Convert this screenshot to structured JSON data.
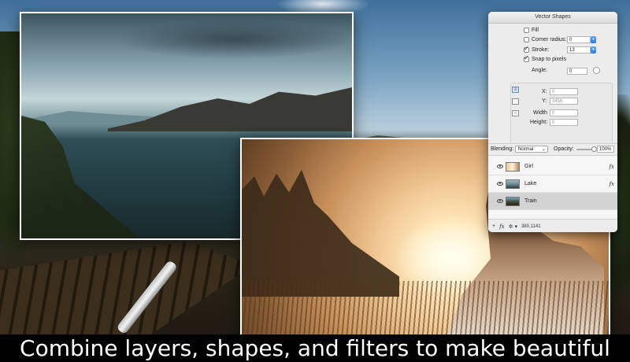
{
  "panel": {
    "title": "Vector Shapes",
    "fill_label": "Fill",
    "fill_checked": false,
    "corner_radius_label": "Corner radius:",
    "corner_radius_checked": false,
    "corner_radius_value": "0",
    "stroke_label": "Stroke:",
    "stroke_checked": true,
    "stroke_value": "13",
    "snap_label": "Snap to pixels",
    "snap_checked": true,
    "angle_label": "Angle:",
    "angle_value": "0",
    "x_label": "X:",
    "x_value": "0",
    "y_label": "Y:",
    "y_value": "3456",
    "width_label": "Width",
    "width_value": "0",
    "height_label": "Height:",
    "height_value": "0",
    "blending_label": "Blending:",
    "blending_value": "Normal",
    "opacity_label": "Opacity:",
    "opacity_value": "100%",
    "opacity_fraction": 1.0,
    "layers": [
      {
        "name": "Girl",
        "fx": "fx",
        "selected": false,
        "thumb": "girl"
      },
      {
        "name": "Lake",
        "fx": "fx",
        "selected": false,
        "thumb": "lake"
      },
      {
        "name": "Train",
        "fx": "",
        "selected": true,
        "thumb": "train"
      }
    ],
    "bottom": {
      "add": "+",
      "fx": "fx",
      "gear": "✲ ▾",
      "coords": "380,1141"
    }
  },
  "caption": "Combine layers, shapes, and filters to make beautiful",
  "icons": {
    "stepper": "stepper-icon",
    "eye": "eye-icon",
    "gear": "gear-icon"
  }
}
